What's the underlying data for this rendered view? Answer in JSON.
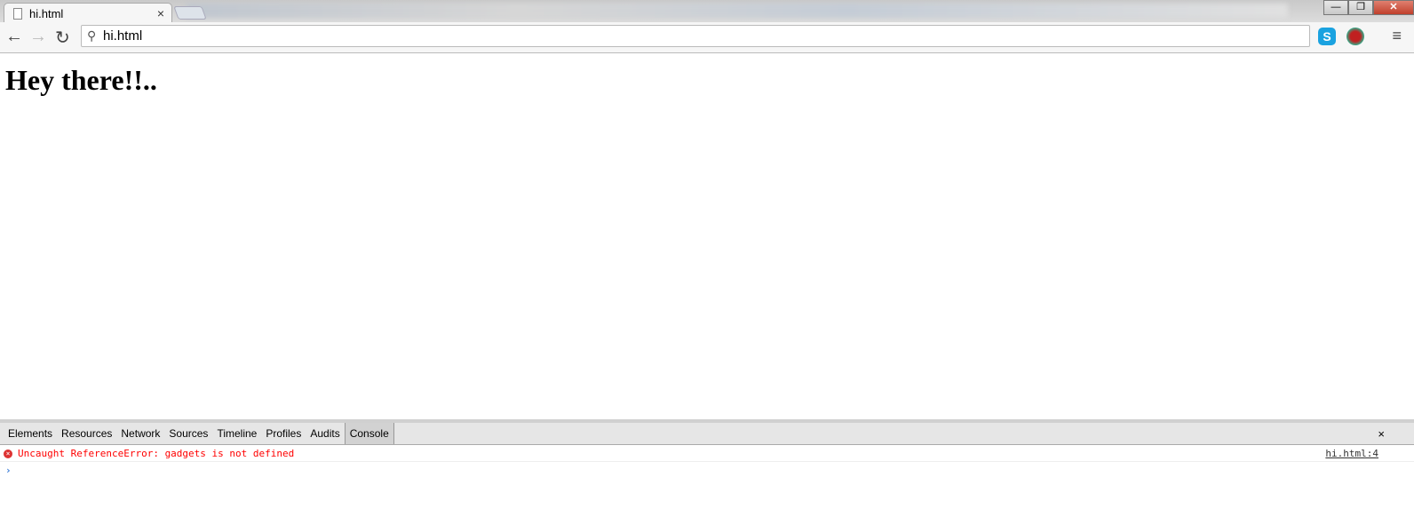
{
  "tab": {
    "title": "hi.html",
    "close": "×"
  },
  "window": {
    "minimize": "—",
    "restore": "❐",
    "close": "✕"
  },
  "toolbar": {
    "back": "←",
    "forward": "→",
    "reload": "↻",
    "url": "hi.html",
    "menu": "≡"
  },
  "extensions": [
    {
      "icon": "skype-icon",
      "color": "#1aa2e0"
    },
    {
      "icon": "globe-extension-icon",
      "color": "#c02020"
    }
  ],
  "page": {
    "heading": "Hey there!!.."
  },
  "devtools": {
    "tabs": [
      "Elements",
      "Resources",
      "Network",
      "Sources",
      "Timeline",
      "Profiles",
      "Audits",
      "Console"
    ],
    "active_tab": "Console",
    "close": "×",
    "console": {
      "error": "Uncaught ReferenceError: gadgets is not defined",
      "source": "hi.html:4",
      "prompt": "›"
    }
  }
}
